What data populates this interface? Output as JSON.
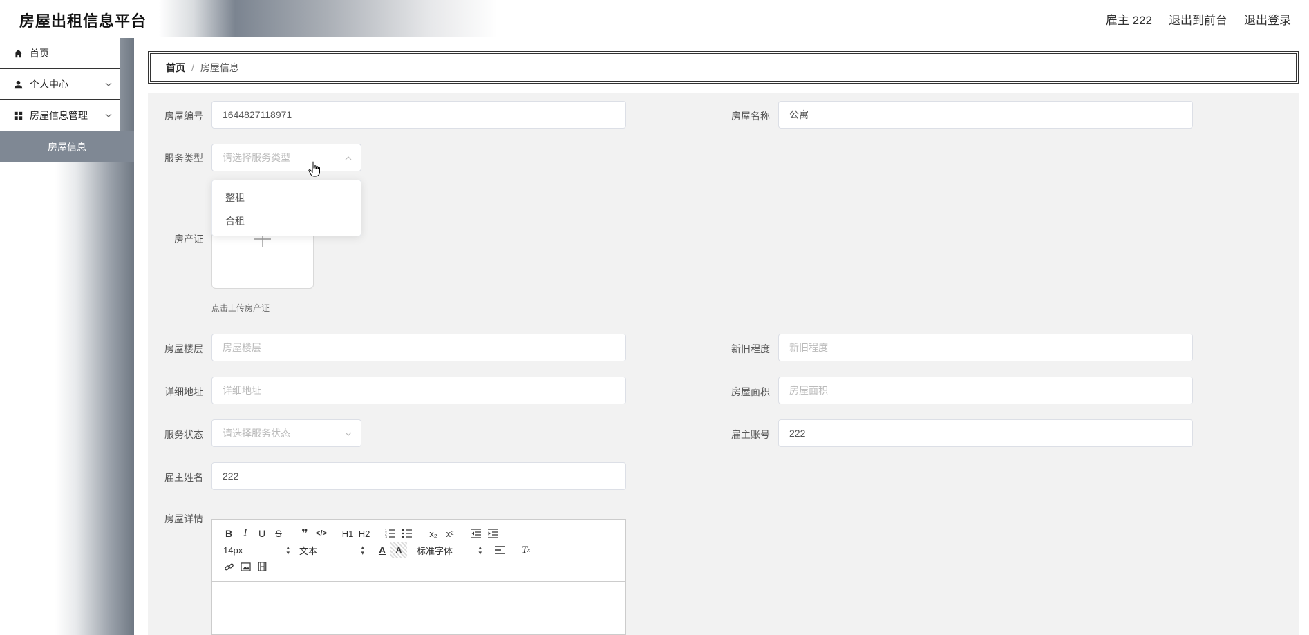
{
  "header": {
    "title": "房屋出租信息平台",
    "user_label": "雇主 222",
    "back_front_label": "退出到前台",
    "logout_label": "退出登录"
  },
  "sidebar": {
    "items": [
      {
        "label": "首页",
        "icon": "home-icon"
      },
      {
        "label": "个人中心",
        "icon": "user-icon"
      },
      {
        "label": "房屋信息管理",
        "icon": "grid-icon"
      }
    ],
    "subitem": "房屋信息"
  },
  "breadcrumb": {
    "home": "首页",
    "separator": "/",
    "current": "房屋信息"
  },
  "form": {
    "house_no": {
      "label": "房屋编号",
      "value": "1644827118971"
    },
    "house_name": {
      "label": "房屋名称",
      "value": "公寓"
    },
    "service_type": {
      "label": "服务类型",
      "placeholder": "请选择服务类型",
      "options": [
        "整租",
        "合租"
      ]
    },
    "certificate": {
      "label": "房产证",
      "hint": "点击上传房产证"
    },
    "floor": {
      "label": "房屋楼层",
      "placeholder": "房屋楼层"
    },
    "condition": {
      "label": "新旧程度",
      "placeholder": "新旧程度"
    },
    "address": {
      "label": "详细地址",
      "placeholder": "详细地址"
    },
    "area": {
      "label": "房屋面积",
      "placeholder": "房屋面积"
    },
    "service_status": {
      "label": "服务状态",
      "placeholder": "请选择服务状态"
    },
    "employer_account": {
      "label": "雇主账号",
      "value": "222"
    },
    "employer_name": {
      "label": "雇主姓名",
      "value": "222"
    },
    "details": {
      "label": "房屋详情"
    }
  },
  "editor": {
    "font_size": "14px",
    "text_type": "文本",
    "font_family": "标准字体",
    "h1": "H1",
    "h2": "H2"
  }
}
